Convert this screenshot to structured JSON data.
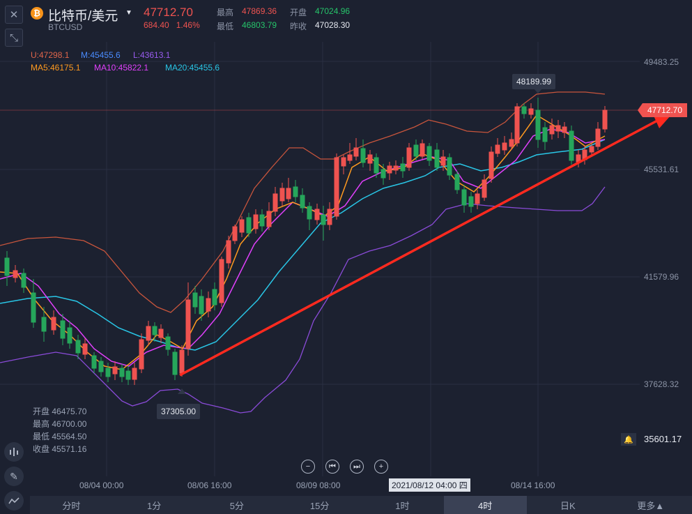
{
  "header": {
    "title": "比特币/美元",
    "symbol": "BTCUSD",
    "price": "47712.70",
    "change": "684.40",
    "change_pct": "1.46%",
    "high_label": "最高",
    "high": "47869.36",
    "open_label": "开盘",
    "open": "47024.96",
    "low_label": "最低",
    "low": "46803.79",
    "prev_label": "昨收",
    "prev": "47028.30"
  },
  "indicators": {
    "boll_u": "U:47298.1",
    "boll_m": "M:45455.6",
    "boll_l": "L:43613.1",
    "ma5": "MA5:46175.1",
    "ma10": "MA10:45822.1",
    "ma20": "MA20:45455.6"
  },
  "y_axis": [
    "49483.25",
    "45531.61",
    "41579.96",
    "37628.32"
  ],
  "current_price_tag": "47712.70",
  "callouts": {
    "max": "48189.99",
    "min": "37305.00"
  },
  "lowest_visible": "35601.17",
  "ohlc_panel": [
    {
      "label": "开盘",
      "value": "46475.70"
    },
    {
      "label": "最高",
      "value": "46700.00"
    },
    {
      "label": "最低",
      "value": "45564.50"
    },
    {
      "label": "收盘",
      "value": "45571.16"
    }
  ],
  "x_axis": [
    "08/04 00:00",
    "08/06 16:00",
    "08/09 08:00",
    "2021/08/12 04:00 四",
    "08/14 16:00"
  ],
  "tabs": [
    {
      "label": "分时"
    },
    {
      "label": "1分"
    },
    {
      "label": "5分"
    },
    {
      "label": "15分"
    },
    {
      "label": "1时"
    },
    {
      "label": "4时"
    },
    {
      "label": "日K"
    },
    {
      "label": "更多▲"
    }
  ],
  "active_tab": "4时",
  "colors": {
    "up": "#ef5350",
    "down": "#26a65b",
    "ma5": "#ff9a1f",
    "ma10": "#e040fb",
    "ma20": "#29c6e6",
    "boll_u": "#c8553c",
    "boll_l": "#8a4bd8",
    "bg": "#1c2130"
  },
  "chart_data": {
    "type": "candlestick",
    "ylim": [
      35601.17,
      49483.25
    ],
    "closes": [
      43200,
      43100,
      42600,
      41900,
      41300,
      40600,
      40000,
      39600,
      39100,
      38700,
      38500,
      38300,
      38150,
      38050,
      37900,
      37850,
      37950,
      38400,
      38900,
      39500,
      40100,
      40700,
      41200,
      41800,
      42300,
      42900,
      43300,
      43700,
      44100,
      44400,
      44700,
      44800,
      44600,
      44500,
      44700,
      44900,
      45100,
      45400,
      45700,
      45900,
      46000,
      46100,
      45800,
      45900,
      46200,
      46400,
      46600,
      46800,
      47000,
      46900,
      46600,
      46400,
      46100,
      45900,
      45700,
      45600,
      45900,
      46400,
      47200,
      47712.7
    ]
  }
}
